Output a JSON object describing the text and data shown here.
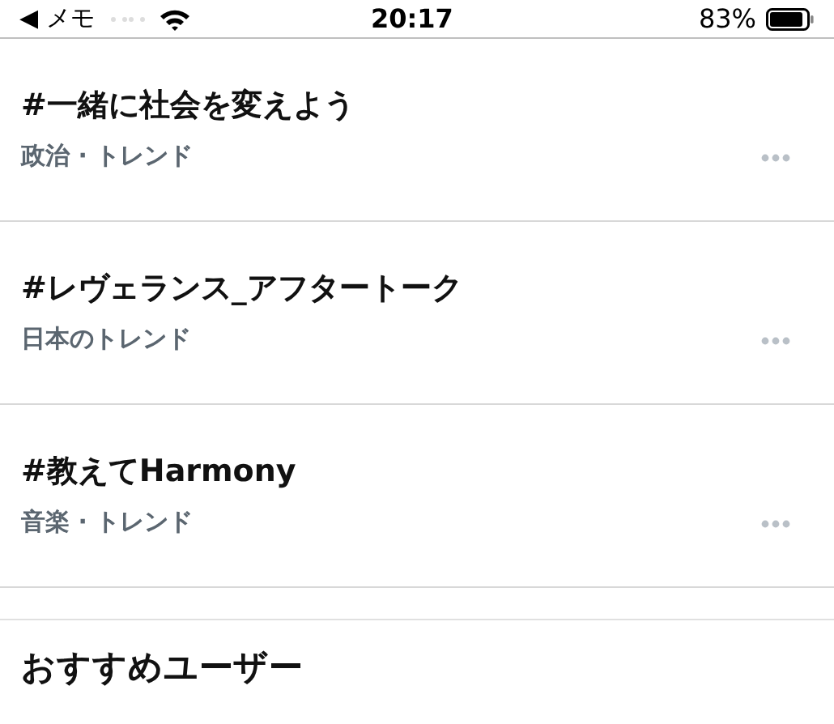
{
  "status_bar": {
    "back_label": "◀ メモ",
    "time": "20:17",
    "battery": "83%"
  },
  "trends": [
    {
      "title": "#一緒に社会を変えよう",
      "context": "政治 · トレンド"
    },
    {
      "title": "#レヴェランス_アフタートーク",
      "context": "日本のトレンド"
    },
    {
      "title": "#教えてHarmony",
      "context": "音楽 · トレンド"
    }
  ],
  "section": {
    "title": "おすすめユーザー"
  }
}
